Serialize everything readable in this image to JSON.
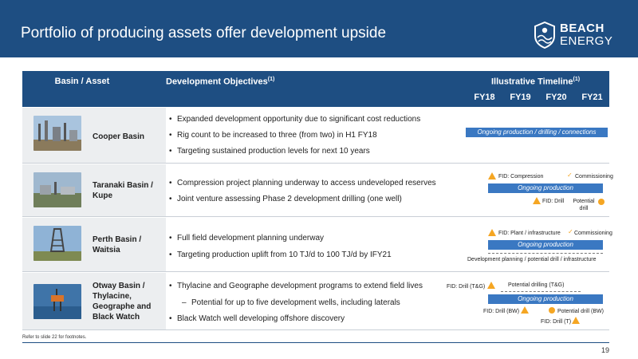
{
  "header": {
    "title": "Portfolio of producing assets offer development upside",
    "logo_word1": "BEACH",
    "logo_word2": "ENERGY"
  },
  "table_header": {
    "basin": "Basin / Asset",
    "dev": "Development Objectives",
    "dev_sup": "(1)",
    "timeline": "Illustrative Timeline",
    "timeline_sup": "(1)",
    "years": [
      "FY18",
      "FY19",
      "FY20",
      "FY21"
    ]
  },
  "rows": [
    {
      "name": "Cooper Basin",
      "bullets": [
        "Expanded development opportunity due to significant cost reductions",
        "Rig count to be increased to three (from two) in H1 FY18",
        "Targeting sustained production levels for next 10 years"
      ],
      "bar": "Ongoing production / drilling / connections"
    },
    {
      "name_lines": [
        "Taranaki Basin /",
        "Kupe"
      ],
      "bullets": [
        "Compression project planning underway to access undeveloped reserves",
        "Joint venture assessing Phase 2 development drilling (one well)"
      ],
      "bar": "Ongoing production",
      "labels": {
        "fid_compression": "FID: Compression",
        "commissioning": "Commissioning",
        "fid_drill": "FID: Drill",
        "potential": "Potential",
        "drill": "drill"
      }
    },
    {
      "name_lines": [
        "Perth Basin /",
        "Waitsia"
      ],
      "bullets": [
        "Full field development planning underway",
        "Targeting production uplift from 10 TJ/d to 100 TJ/d by IFY21"
      ],
      "bar": "Ongoing production",
      "labels": {
        "fid_plant": "FID: Plant / infrastructure",
        "commissioning": "Commissioning",
        "dev_planning": "Development planning / potential drill / infrastructure"
      }
    },
    {
      "name_lines": [
        "Otway Basin /",
        "Thylacine,",
        "Geographe and",
        "Black Watch"
      ],
      "bullets": [
        "Thylacine and Geographe development programs to extend field lives",
        "Potential for up to five development wells, including laterals",
        "Black Watch well developing offshore discovery"
      ],
      "bar": "Ongoing production",
      "labels": {
        "fid_drill_tg": "FID: Drill (T&G)",
        "potential_drilling_tg": "Potential drilling (T&G)",
        "fid_drill_bw": "FID: Drill (BW)",
        "potential_drill_bw": "Potential drill (BW)",
        "fid_drill_t": "FID: Drill (T)"
      }
    }
  ],
  "footnote": "Refer to slide 22 for footnotes.",
  "page_number": "19",
  "colors": {
    "navy": "#1e4e82",
    "bar_blue": "#3a78c2",
    "milestone_orange": "#f5a623",
    "basin_cell_grey": "#eceef0"
  },
  "icons": {
    "milestone": "orange-triangle",
    "potential": "orange-circle",
    "commissioning": "check-mark"
  }
}
